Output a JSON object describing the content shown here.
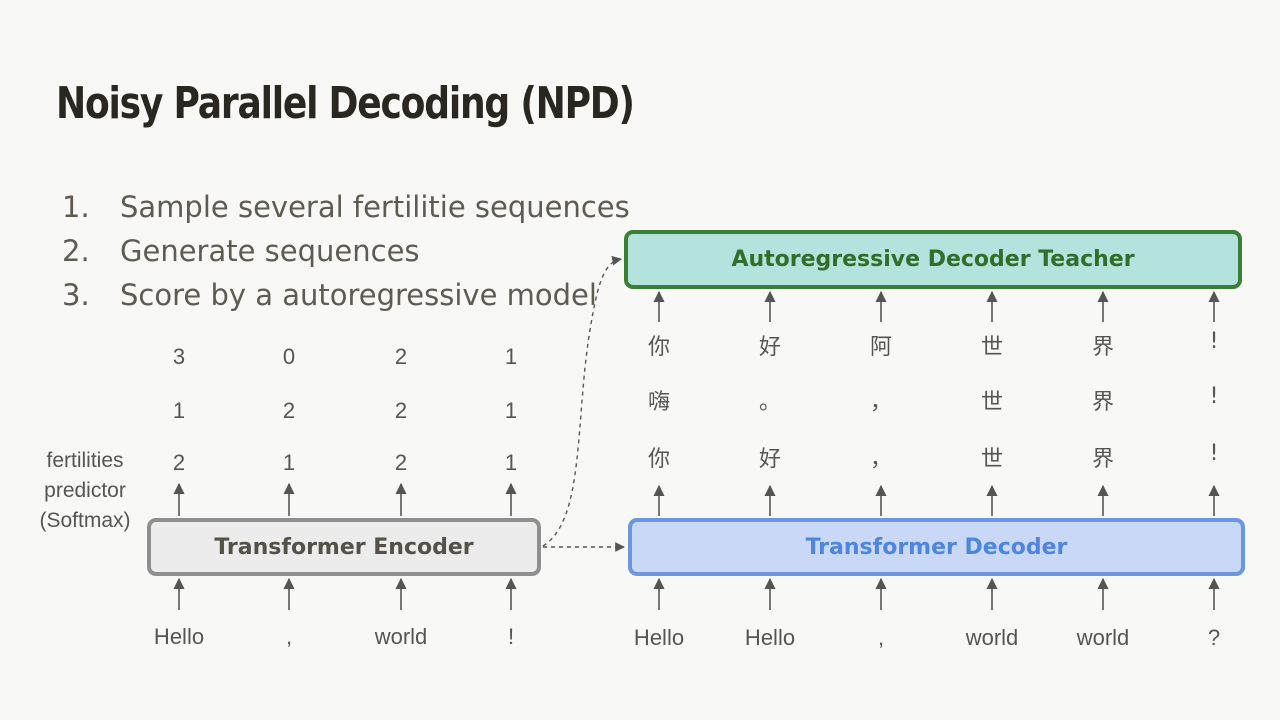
{
  "title": "Noisy Parallel Decoding (NPD)",
  "steps": [
    {
      "num": "1.",
      "text": "Sample several fertilitie sequences"
    },
    {
      "num": "2.",
      "text": "Generate sequences"
    },
    {
      "num": "3.",
      "text": "Score by a autoregressive model"
    }
  ],
  "encoder": {
    "label": "Transformer Encoder",
    "inputs": [
      "Hello",
      ",",
      "world",
      "!"
    ],
    "fertility_label": [
      "fertilities",
      "predictor",
      "(Softmax)"
    ],
    "fertility_rows": [
      [
        "3",
        "0",
        "2",
        "1"
      ],
      [
        "1",
        "2",
        "2",
        "1"
      ],
      [
        "2",
        "1",
        "2",
        "1"
      ]
    ]
  },
  "decoder": {
    "label": "Transformer Decoder",
    "inputs": [
      "Hello",
      "Hello",
      ",",
      "world",
      "world",
      "?"
    ],
    "output_rows": [
      [
        "你",
        "好",
        "阿",
        "世",
        "界",
        "!"
      ],
      [
        "嗨",
        "。",
        "，",
        "世",
        "界",
        "!"
      ],
      [
        "你",
        "好",
        "，",
        "世",
        "界",
        "!"
      ]
    ]
  },
  "teacher": {
    "label": "Autoregressive Decoder Teacher"
  },
  "colors": {
    "encoder_fill": "#ececec",
    "encoder_border": "#8f8f8f",
    "decoder_fill": "#c8d8f6",
    "decoder_border": "#6a96e2",
    "teacher_fill": "#b4e2dc",
    "teacher_border": "#3b7f34",
    "annotation": "#d9323a"
  }
}
